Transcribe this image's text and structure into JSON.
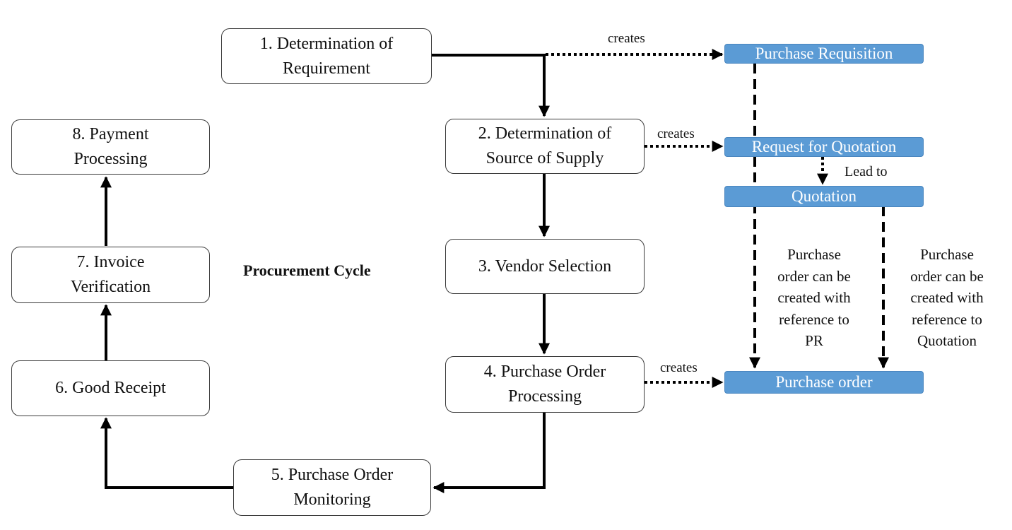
{
  "diagram": {
    "title": "Procurement Cycle",
    "steps": [
      {
        "id": "s1",
        "line1": "1. Determination of",
        "line2": "Requirement"
      },
      {
        "id": "s2",
        "line1": "2. Determination of",
        "line2": "Source of Supply"
      },
      {
        "id": "s3",
        "line1": "3. Vendor Selection",
        "line2": ""
      },
      {
        "id": "s4",
        "line1": "4. Purchase Order",
        "line2": "Processing"
      },
      {
        "id": "s5",
        "line1": "5. Purchase Order",
        "line2": "Monitoring"
      },
      {
        "id": "s6",
        "line1": "6. Good Receipt",
        "line2": ""
      },
      {
        "id": "s7",
        "line1": "7. Invoice",
        "line2": "Verification"
      },
      {
        "id": "s8",
        "line1": "8. Payment",
        "line2": "Processing"
      }
    ],
    "documents": [
      {
        "id": "pr",
        "label": "Purchase Requisition"
      },
      {
        "id": "rfq",
        "label": "Request for Quotation"
      },
      {
        "id": "quo",
        "label": "Quotation"
      },
      {
        "id": "po",
        "label": "Purchase order"
      }
    ],
    "edge_labels": {
      "creates_pr": "creates",
      "creates_rfq": "creates",
      "creates_po": "creates",
      "lead_to": "Lead to"
    },
    "notes": {
      "ref_pr": [
        "Purchase",
        "order can be",
        "created with",
        "reference to",
        "PR"
      ],
      "ref_quotation": [
        "Purchase",
        "order can be",
        "created with",
        "reference to",
        "Quotation"
      ]
    },
    "colors": {
      "document_fill": "#5b9bd5",
      "document_text": "#ffffff",
      "step_border": "#3a3a3a",
      "connector": "#000000"
    }
  }
}
